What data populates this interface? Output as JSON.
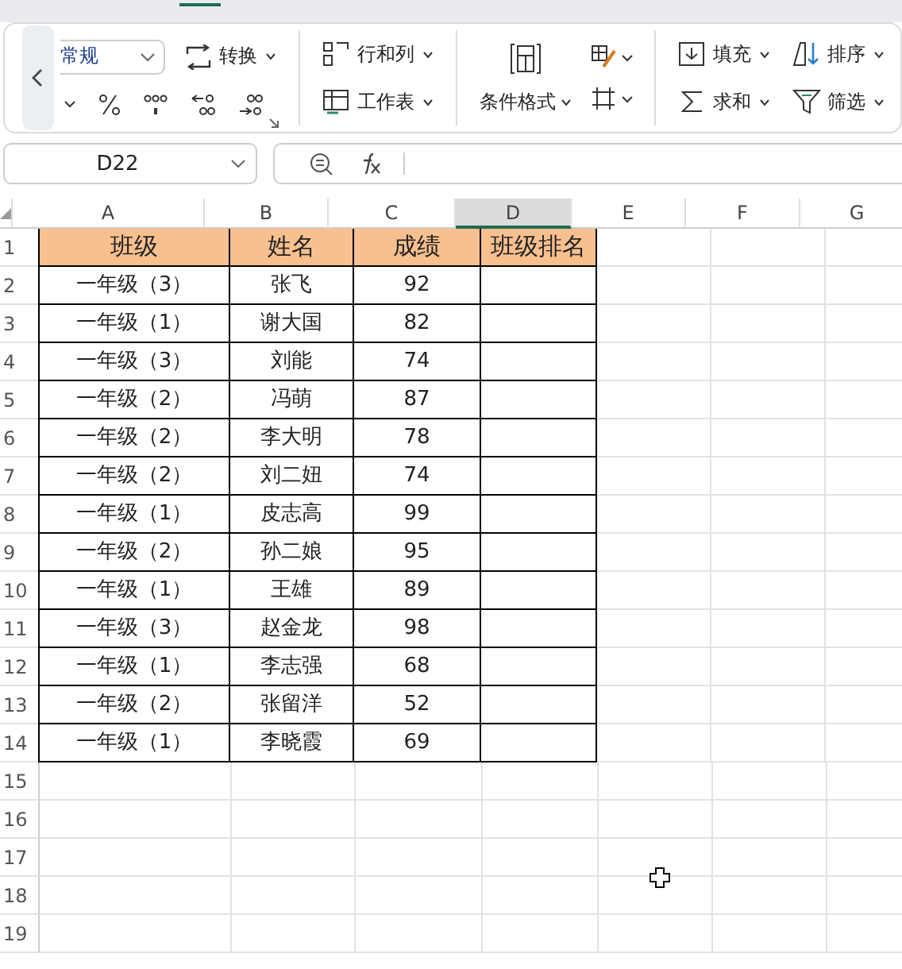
{
  "ribbon": {
    "number_format": {
      "value": "常规"
    },
    "convert": "转换",
    "rows_cols": "行和列",
    "worksheet": "工作表",
    "conditional_format": "条件格式",
    "fill": "填充",
    "sum": "求和",
    "sort": "排序",
    "filter": "筛选"
  },
  "formula_bar": {
    "name_box": "D22"
  },
  "sheet": {
    "columns": [
      {
        "label": "A",
        "selected": false
      },
      {
        "label": "B",
        "selected": false
      },
      {
        "label": "C",
        "selected": false
      },
      {
        "label": "D",
        "selected": true
      },
      {
        "label": "E",
        "selected": false
      },
      {
        "label": "F",
        "selected": false
      },
      {
        "label": "G",
        "selected": false
      }
    ],
    "rows": [
      {
        "number": "1",
        "kind": "header",
        "cells": [
          "班级",
          "姓名",
          "成绩",
          "班级排名"
        ]
      },
      {
        "number": "2",
        "kind": "data",
        "cells": [
          "一年级（3）",
          "张飞",
          "92",
          ""
        ]
      },
      {
        "number": "3",
        "kind": "data",
        "cells": [
          "一年级（1）",
          "谢大国",
          "82",
          ""
        ]
      },
      {
        "number": "4",
        "kind": "data",
        "cells": [
          "一年级（3）",
          "刘能",
          "74",
          ""
        ]
      },
      {
        "number": "5",
        "kind": "data",
        "cells": [
          "一年级（2）",
          "冯萌",
          "87",
          ""
        ]
      },
      {
        "number": "6",
        "kind": "data",
        "cells": [
          "一年级（2）",
          "李大明",
          "78",
          ""
        ]
      },
      {
        "number": "7",
        "kind": "data",
        "cells": [
          "一年级（2）",
          "刘二妞",
          "74",
          ""
        ]
      },
      {
        "number": "8",
        "kind": "data",
        "cells": [
          "一年级（1）",
          "皮志高",
          "99",
          ""
        ]
      },
      {
        "number": "9",
        "kind": "data",
        "cells": [
          "一年级（2）",
          "孙二娘",
          "95",
          ""
        ]
      },
      {
        "number": "10",
        "kind": "data",
        "cells": [
          "一年级（1）",
          "王雄",
          "89",
          ""
        ]
      },
      {
        "number": "11",
        "kind": "data",
        "cells": [
          "一年级（3）",
          "赵金龙",
          "98",
          ""
        ]
      },
      {
        "number": "12",
        "kind": "data",
        "cells": [
          "一年级（1）",
          "李志强",
          "68",
          ""
        ]
      },
      {
        "number": "13",
        "kind": "data",
        "cells": [
          "一年级（2）",
          "张留洋",
          "52",
          ""
        ]
      },
      {
        "number": "14",
        "kind": "data",
        "cells": [
          "一年级（1）",
          "李晓霞",
          "69",
          ""
        ]
      },
      {
        "number": "15",
        "cells": []
      },
      {
        "number": "16",
        "cells": []
      },
      {
        "number": "17",
        "cells": []
      },
      {
        "number": "18",
        "cells": []
      },
      {
        "number": "19",
        "cells": []
      }
    ]
  }
}
